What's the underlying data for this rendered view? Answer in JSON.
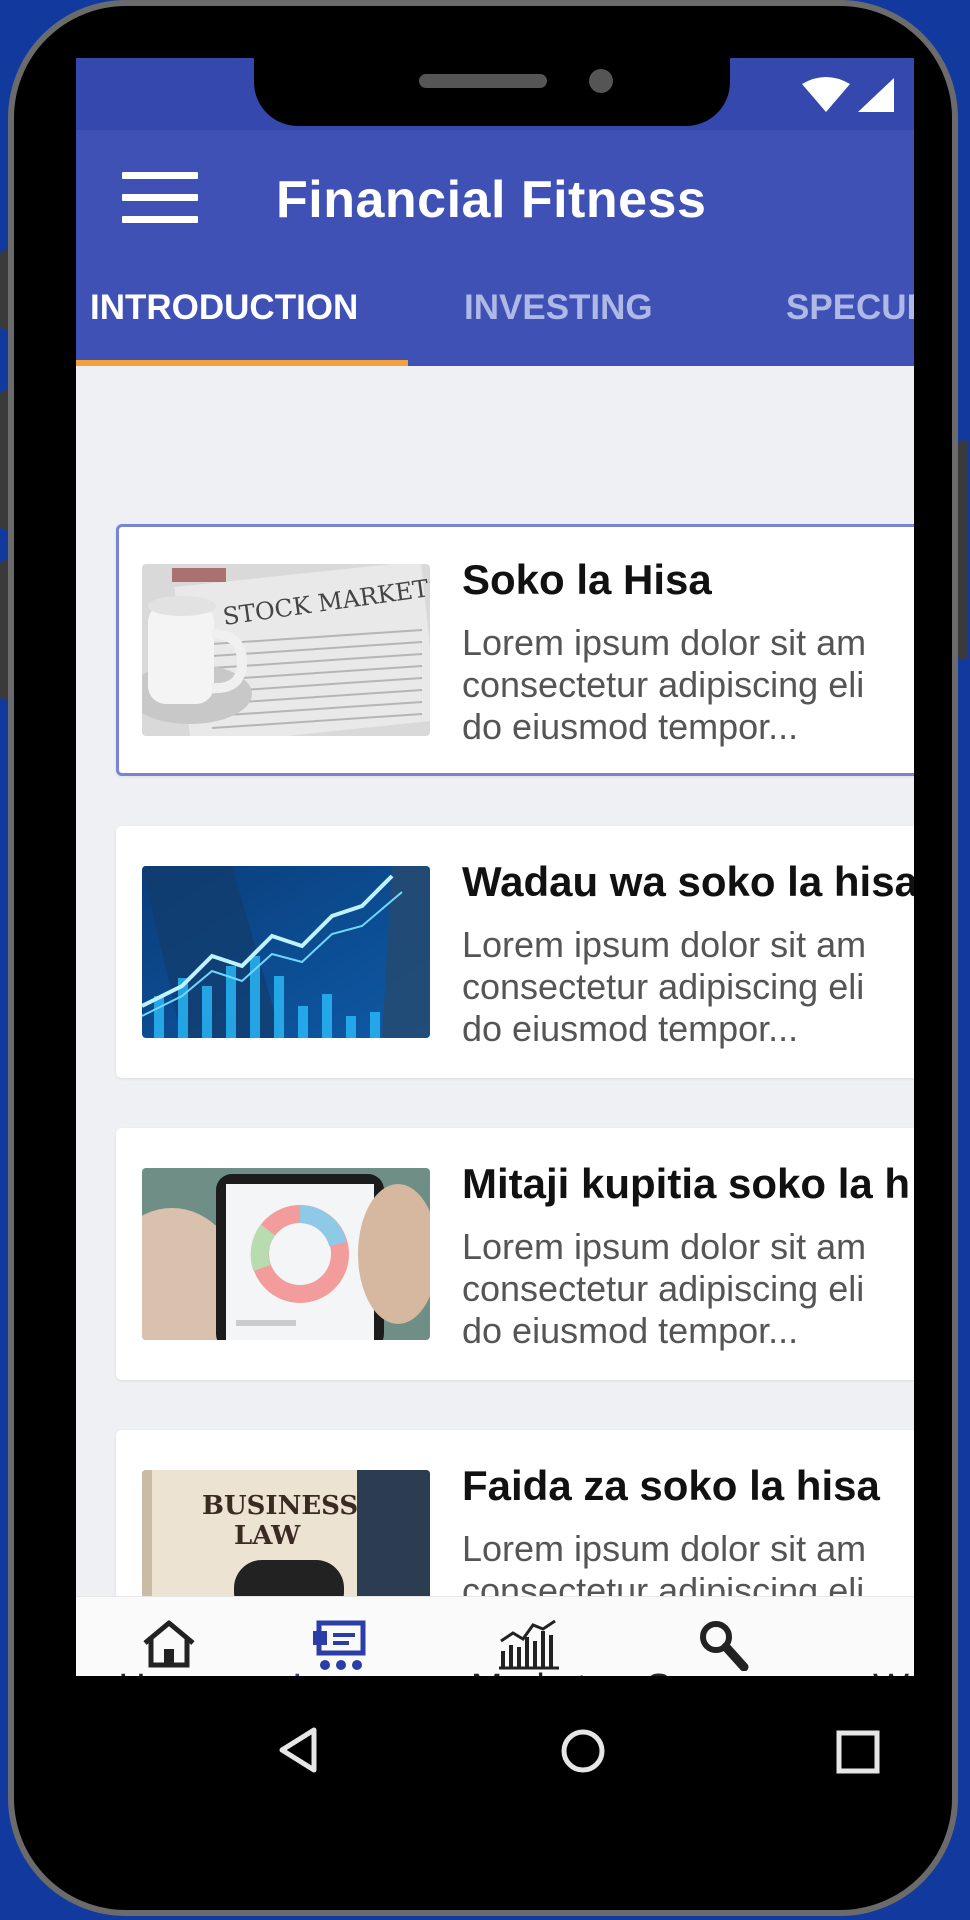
{
  "app": {
    "title": "Financial Fitness"
  },
  "tabs": [
    {
      "label": "INTRODUCTION",
      "active": true
    },
    {
      "label": "INVESTING",
      "active": false
    },
    {
      "label": "SPECUL",
      "active": false
    }
  ],
  "lessons": [
    {
      "title": "Soko la Hisa",
      "description": "Lorem ipsum dolor sit am\nconsectetur adipiscing eli\ndo eiusmod tempor...",
      "thumbnail_label": "STOCK MARKETS",
      "selected": true
    },
    {
      "title": "Wadau wa soko la hisa",
      "description": "Lorem ipsum dolor sit am\nconsectetur adipiscing eli\ndo eiusmod tempor...",
      "selected": false
    },
    {
      "title": "Mitaji kupitia soko la h",
      "description": "Lorem ipsum dolor sit am\nconsectetur adipiscing eli\ndo eiusmod tempor...",
      "selected": false
    },
    {
      "title": "Faida za soko la hisa",
      "description": "Lorem ipsum dolor sit am\nconsectetur adipiscing eli\ndo eiusmod tempor...",
      "thumbnail_label": "BUSINESS\nLAW",
      "selected": false
    }
  ],
  "bottom_nav": [
    {
      "label": "Home",
      "icon": "home-icon",
      "active": false
    },
    {
      "label": "Learn",
      "icon": "learn-icon",
      "active": true
    },
    {
      "label": "Market",
      "icon": "market-chart-icon",
      "active": false
    },
    {
      "label": "Screener",
      "icon": "search-icon",
      "active": false
    },
    {
      "label": "W",
      "icon": "",
      "active": false
    }
  ],
  "colors": {
    "background": "#123a9e",
    "app_bar": "#3f51b5",
    "tab_indicator": "#f2a23c",
    "active_nav": "#2b3ea8"
  }
}
